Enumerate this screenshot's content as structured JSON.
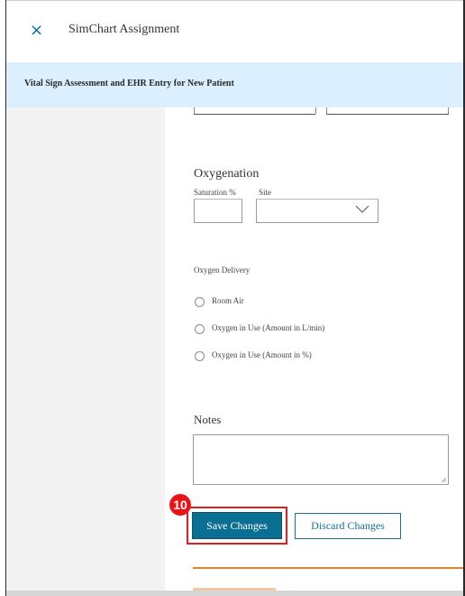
{
  "header": {
    "close_icon": "×",
    "title": "SimChart Assignment"
  },
  "banner": {
    "title": "Vital Sign Assessment and EHR Entry for New Patient"
  },
  "oxygenation": {
    "heading": "Oxygenation",
    "saturation_label": "Saturation %",
    "saturation_value": "",
    "site_label": "Site",
    "site_value": ""
  },
  "oxygen_delivery": {
    "label": "Oxygen Delivery",
    "options": [
      "Room Air",
      "Oxygen in Use (Amount in L/min)",
      "Oxygen in Use (Amount in %)"
    ]
  },
  "notes": {
    "heading": "Notes",
    "value": ""
  },
  "annotation": {
    "step": "10"
  },
  "buttons": {
    "save": "Save Changes",
    "discard": "Discard Changes"
  },
  "colors": {
    "banner": "#dcefff",
    "primary": "#0a6f92",
    "accent": "#e8822d",
    "highlight": "#e01e1e"
  }
}
